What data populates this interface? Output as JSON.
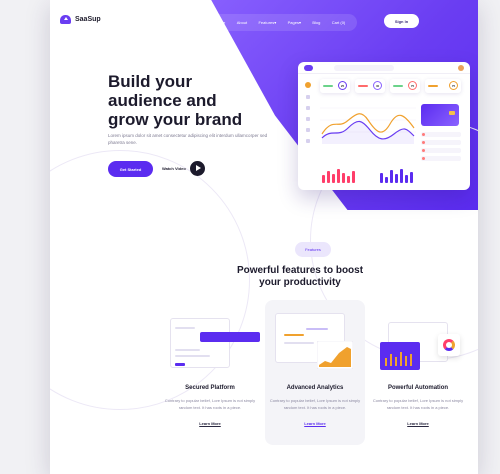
{
  "brand": {
    "name": "SaaSup"
  },
  "nav": {
    "items": [
      "Home",
      "About",
      "Features▾",
      "Pages▾",
      "Blog",
      "Cart (0)"
    ],
    "signin_label": "Sign In"
  },
  "hero": {
    "title_lines": [
      "Build your",
      "audience and",
      "grow your brand"
    ],
    "lead": "Lorem ipsum dolor sit amet consectetur adipiscing elit interdum ullamcorper sed pharetra sene.",
    "start_label": "Get Started",
    "watch_label": "Watch Video"
  },
  "dashboard": {
    "stats": [
      "25",
      "40",
      "75",
      "75"
    ],
    "accent": "#5b2cf0",
    "highlight": "#f0a12e"
  },
  "features": {
    "pill": "Features",
    "heading_lines": [
      "Powerful features to boost",
      "your productivity"
    ],
    "items": [
      {
        "title": "Secured Platform",
        "desc": "Contrary to popular belief, Lore Ipsum is not simply random text. It has roots in a piece.",
        "more": "Learn More"
      },
      {
        "title": "Advanced Analytics",
        "desc": "Contrary to popular belief, Lore Ipsum is not simply random text. It has roots in a piece.",
        "more": "Learn More"
      },
      {
        "title": "Powerful Automation",
        "desc": "Contrary to popular belief, Lore Ipsum is not simply random text. It has roots in a piece.",
        "more": "Learn More"
      }
    ]
  },
  "colors": {
    "primary": "#5b2cf0",
    "dark": "#1c1a2c",
    "orange": "#f0a12e",
    "pink": "#ff3e6a"
  }
}
